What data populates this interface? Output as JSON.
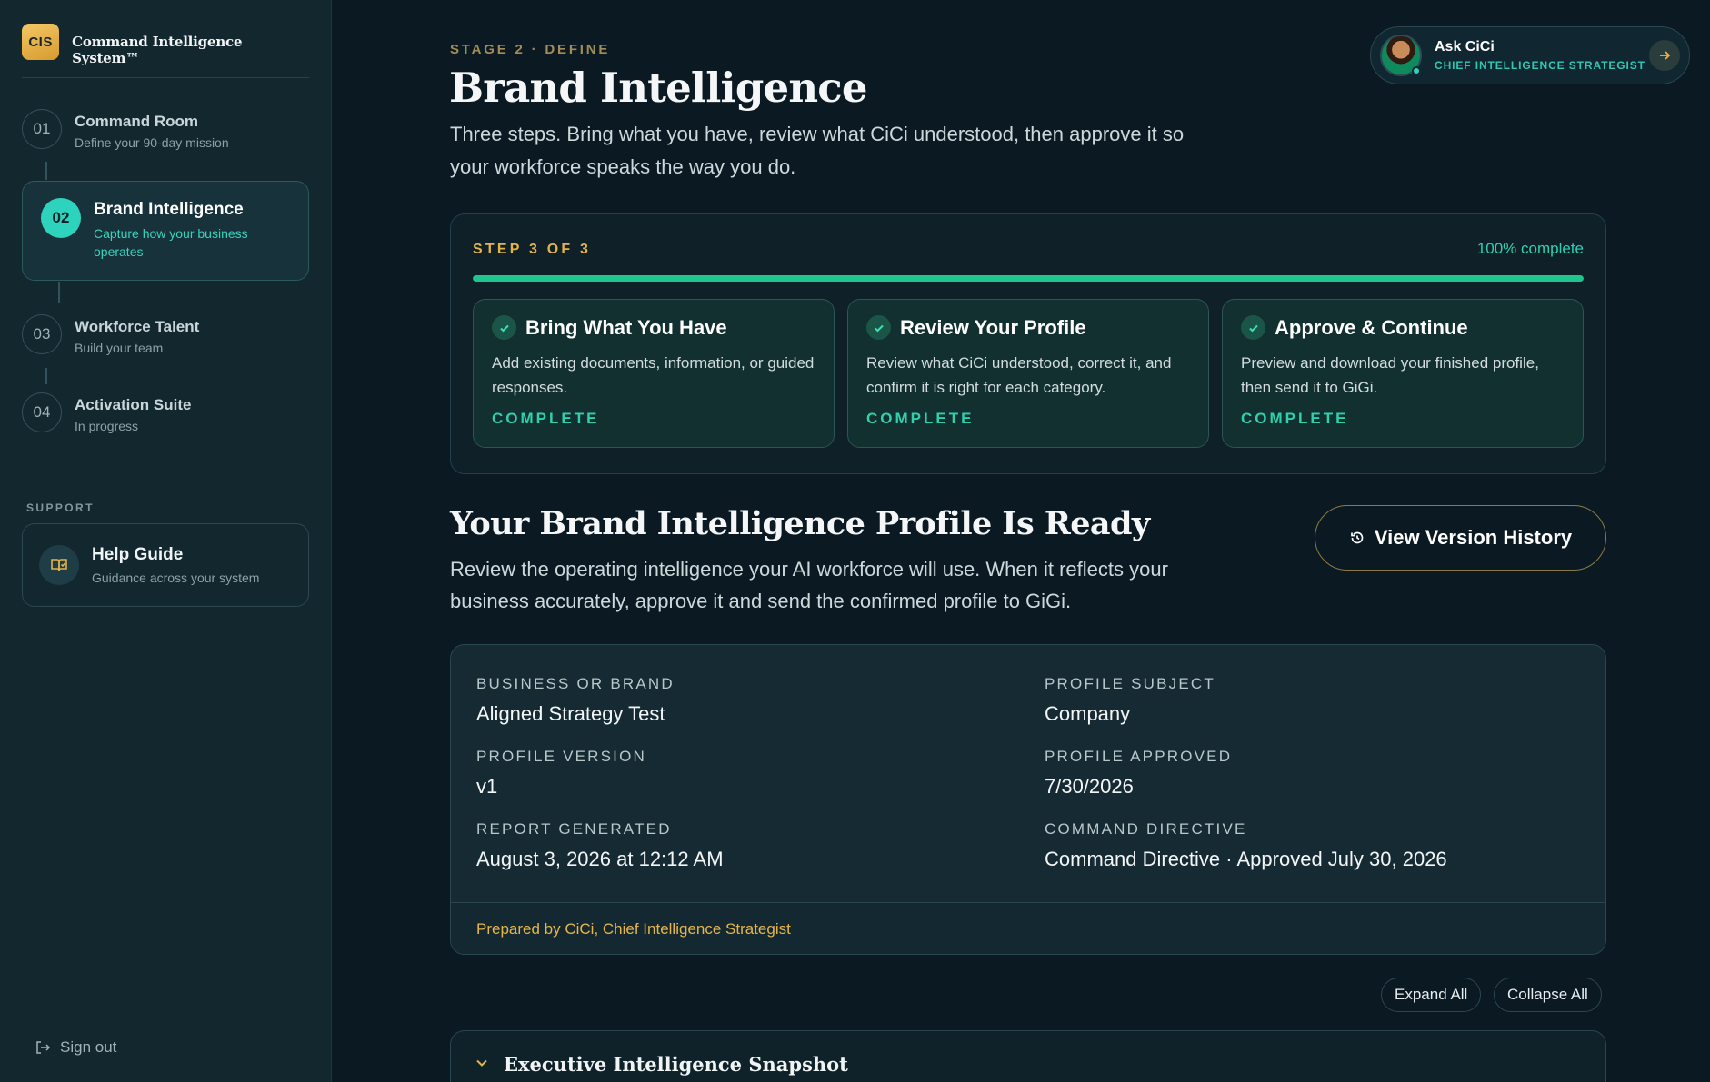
{
  "sidebar": {
    "logo_text": "CIS",
    "app_name": "Command Intelligence System™",
    "items": [
      {
        "num": "01",
        "title": "Command Room",
        "subtitle": "Define your 90-day mission"
      },
      {
        "num": "02",
        "title": "Brand Intelligence",
        "subtitle": "Capture how your business operates"
      },
      {
        "num": "03",
        "title": "Workforce Talent",
        "subtitle": "Build your team"
      },
      {
        "num": "04",
        "title": "Activation Suite",
        "subtitle": "In progress"
      }
    ],
    "support_label": "SUPPORT",
    "help": {
      "title": "Help Guide",
      "subtitle": "Guidance across your system",
      "icon": "book-icon"
    },
    "signout": "Sign out"
  },
  "header": {
    "stage": "STAGE 2 · DEFINE",
    "title": "Brand Intelligence",
    "intro": "Three steps. Bring what you have, review what CiCi understood, then approve it so your workforce speaks the way you do."
  },
  "assistant": {
    "name": "Ask CiCi",
    "role": "CHIEF INTELLIGENCE STRATEGIST"
  },
  "steps": {
    "count_label": "STEP 3 OF 3",
    "percent_label": "100% complete",
    "progress": 1.0,
    "items": [
      {
        "title": "Bring What You Have",
        "desc": "Add existing documents, information, or guided responses.",
        "status": "COMPLETE"
      },
      {
        "title": "Review Your Profile",
        "desc": "Review what CiCi understood, correct it, and confirm it is right for each category.",
        "status": "COMPLETE"
      },
      {
        "title": "Approve & Continue",
        "desc": "Preview and download your finished profile, then send it to GiGi.",
        "status": "COMPLETE"
      }
    ]
  },
  "ready": {
    "title": "Your Brand Intelligence Profile Is Ready",
    "desc": "Review the operating intelligence your AI workforce will use. When it reflects your business accurately, approve it and send the confirmed profile to GiGi.",
    "version_history": "View Version History"
  },
  "profile": {
    "fields": [
      {
        "label": "BUSINESS OR BRAND",
        "value": "Aligned Strategy Test"
      },
      {
        "label": "PROFILE SUBJECT",
        "value": "Company"
      },
      {
        "label": "PROFILE VERSION",
        "value": "v1"
      },
      {
        "label": "PROFILE APPROVED",
        "value": "7/30/2026"
      },
      {
        "label": "REPORT GENERATED",
        "value": "August 3, 2026 at 12:12 AM"
      },
      {
        "label": "COMMAND DIRECTIVE",
        "value": "Command Directive · Approved July 30, 2026"
      }
    ],
    "prepared_by": "Prepared by CiCi, Chief Intelligence Strategist"
  },
  "controls": {
    "expand_all": "Expand All",
    "collapse_all": "Collapse All"
  },
  "sections": [
    {
      "title": "Executive Intelligence Snapshot"
    }
  ],
  "colors": {
    "accent_teal": "#2ed3bd",
    "accent_gold": "#e3b44a",
    "progress_green": "#1fc48f",
    "background": "#0b1a22"
  }
}
